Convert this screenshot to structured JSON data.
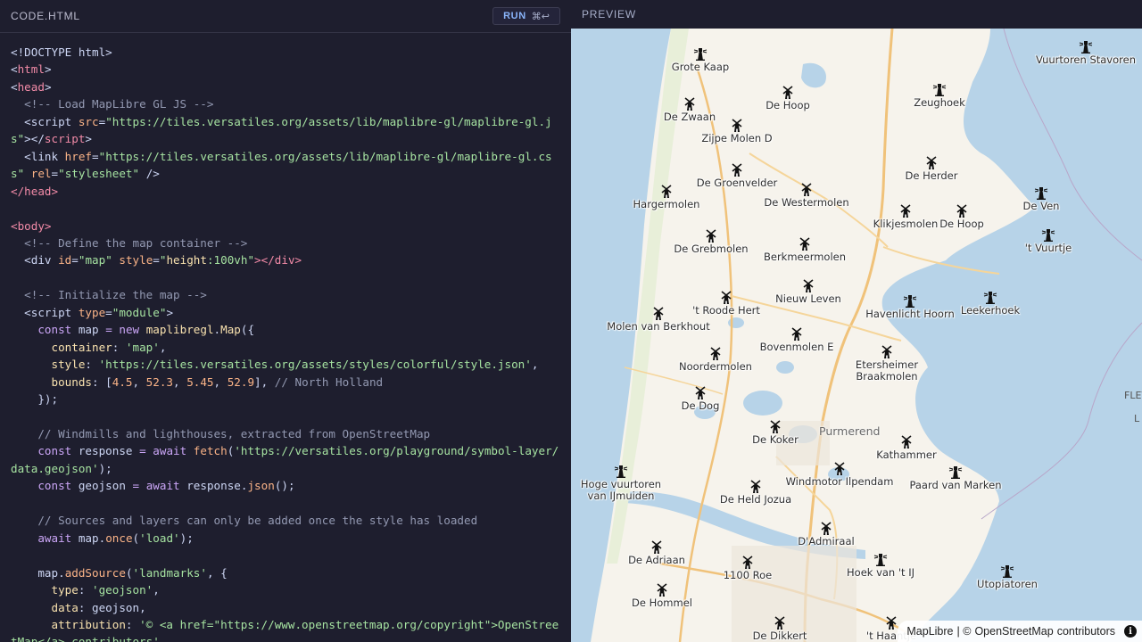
{
  "code": {
    "title": "CODE.HTML",
    "run_label": "RUN",
    "run_shortcut": "⌘↩",
    "lines": {
      "l1": "<!DOCTYPE html>",
      "l2a": "<",
      "l2b": "html",
      "l2c": ">",
      "l3a": "<",
      "l3b": "head",
      "l3c": ">",
      "c1": "<!-- Load MapLibre GL JS -->",
      "script_open": "<script",
      "src_attr": " src",
      "src_val": "\"https://tiles.versatiles.org/assets/lib/maplibre-gl/maplibre-gl.js\"",
      "script_close_a": "></",
      "script_close_b": "script",
      "link_tag": "<link",
      "href_attr": " href",
      "href_val": "\"https://tiles.versatiles.org/assets/lib/maplibre-gl/maplibre-gl.css\"",
      "rel_attr": " rel",
      "rel_val": "\"stylesheet\"",
      "link_end": " />",
      "head_close": "</head>",
      "body_open": "<body>",
      "c2": "<!-- Define the map container -->",
      "div_open": "<div",
      "id_attr": " id",
      "id_val": "\"map\"",
      "style_attr": " style",
      "style_val_a": "\"",
      "style_prop": "height",
      "style_val_b": ":100vh\"",
      "div_close": "></div>",
      "c3": "<!-- Initialize the map -->",
      "type_attr": " type",
      "type_val": "\"module\"",
      "gt": ">",
      "kw_const": "const",
      "var_map": " map ",
      "eq": "=",
      "kw_new": " new ",
      "ns": "maplibregl",
      "dot": ".",
      "cls_map": "Map",
      "open_obj": "({",
      "p_container": "container",
      "v_container": "'map'",
      "p_style": "style",
      "v_style": "'https://tiles.versatiles.org/assets/styles/colorful/style.json'",
      "p_bounds": "bounds",
      "n1": "4.5",
      "n2": "52.3",
      "n3": "5.45",
      "n4": "52.9",
      "c4": "// North Holland",
      "close_obj": "});",
      "c5": "// Windmills and lighthouses, extracted from OpenStreetMap",
      "var_response": " response ",
      "kw_await": "await",
      "fn_fetch": "fetch",
      "v_url": "'https://versatiles.org/playground/symbol-layer/data.geojson'",
      "var_geojson": " geojson ",
      "var_response2": " response",
      "fn_json": "json",
      "c6": "// Sources and layers can only be added once the style has loaded",
      "var_map2": " map",
      "fn_once": "once",
      "v_load": "'load'",
      "var_map3": "map",
      "fn_addSource": "addSource",
      "v_landmarks": "'landmarks'",
      "p_type": "type",
      "v_geojson": "'geojson'",
      "p_data": "data",
      "v_data": " geojson,",
      "p_attribution": "attribution",
      "v_attr1": "'© <a href=\"https://www.openstreetmap.org/copyright\">OpenStreetMap</a> contributors',"
    }
  },
  "preview": {
    "title": "PREVIEW",
    "attribution": {
      "maplibre": "MapLibre",
      "separator": " | © ",
      "osm": "OpenStreetMap",
      "contributors": "contributors",
      "info": "i"
    },
    "town_label": "Purmerend",
    "edge_labels": [
      "FLEV",
      "L"
    ],
    "landmarks": [
      {
        "name": "Grote Kaap",
        "kind": "lighthouse"
      },
      {
        "name": "Vuurtoren Stavoren",
        "kind": "lighthouse"
      },
      {
        "name": "De Zwaan",
        "kind": "windmill"
      },
      {
        "name": "De Hoop",
        "kind": "windmill"
      },
      {
        "name": "Zeughoek",
        "kind": "lighthouse"
      },
      {
        "name": "Zijpe Molen D",
        "kind": "windmill"
      },
      {
        "name": "De Groenvelder",
        "kind": "windmill"
      },
      {
        "name": "De Herder",
        "kind": "windmill"
      },
      {
        "name": "Hargermolen",
        "kind": "windmill"
      },
      {
        "name": "De Westermolen",
        "kind": "windmill"
      },
      {
        "name": "De Ven",
        "kind": "lighthouse"
      },
      {
        "name": "Klikjesmolen",
        "kind": "windmill"
      },
      {
        "name": "De Hoop",
        "kind": "windmill"
      },
      {
        "name": "De Grebmolen",
        "kind": "windmill"
      },
      {
        "name": "Berkmeermolen",
        "kind": "windmill"
      },
      {
        "name": "'t Vuurtje",
        "kind": "lighthouse"
      },
      {
        "name": "Nieuw Leven",
        "kind": "windmill"
      },
      {
        "name": "'t Roode Hert",
        "kind": "windmill"
      },
      {
        "name": "Havenlicht Hoorn",
        "kind": "lighthouse"
      },
      {
        "name": "Leekerhoek",
        "kind": "lighthouse"
      },
      {
        "name": "Molen van Berkhout",
        "kind": "windmill"
      },
      {
        "name": "Bovenmolen E",
        "kind": "windmill"
      },
      {
        "name": "Noordermolen",
        "kind": "windmill"
      },
      {
        "name": "Etersheimer Braakmolen",
        "kind": "windmill"
      },
      {
        "name": "De Dog",
        "kind": "windmill"
      },
      {
        "name": "De Koker",
        "kind": "windmill"
      },
      {
        "name": "Kathammer",
        "kind": "windmill"
      },
      {
        "name": "Hoge vuurtoren van IJmuiden",
        "kind": "lighthouse"
      },
      {
        "name": "Windmotor Ilpendam",
        "kind": "windmill"
      },
      {
        "name": "Paard van Marken",
        "kind": "lighthouse"
      },
      {
        "name": "De Held Jozua",
        "kind": "windmill"
      },
      {
        "name": "D'Admiraal",
        "kind": "windmill"
      },
      {
        "name": "De Adriaan",
        "kind": "windmill"
      },
      {
        "name": "1100 Roe",
        "kind": "windmill"
      },
      {
        "name": "Hoek van 't IJ",
        "kind": "lighthouse"
      },
      {
        "name": "Utopiatoren",
        "kind": "lighthouse"
      },
      {
        "name": "De Hommel",
        "kind": "windmill"
      },
      {
        "name": "De Dikkert",
        "kind": "windmill"
      },
      {
        "name": "'t Haantje",
        "kind": "windmill"
      }
    ]
  }
}
